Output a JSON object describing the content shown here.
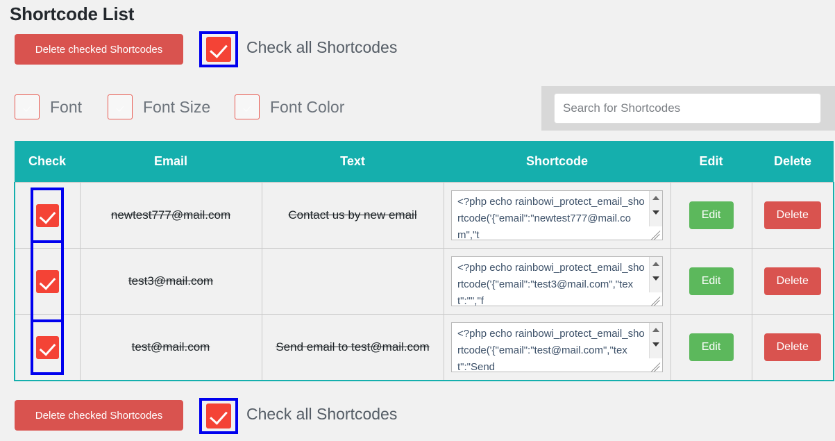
{
  "page": {
    "title": "Shortcode List",
    "colors": {
      "table_header_teal": "#15afad",
      "danger_red": "#d9534f",
      "checkbox_red": "#f44336",
      "edit_green": "#5cb85c",
      "focus_blue": "#0000ee",
      "page_background": "#f1f1f1",
      "search_panel_gray": "#d8d8d8"
    }
  },
  "toolbar_top": {
    "delete_checked_label": "Delete checked Shortcodes",
    "check_all_label": "Check all Shortcodes",
    "check_all_checked": true
  },
  "toolbar_bottom": {
    "delete_checked_label": "Delete checked Shortcodes",
    "check_all_label": "Check all Shortcodes",
    "check_all_checked": true
  },
  "filters": [
    {
      "label": "Font",
      "checked": false
    },
    {
      "label": "Font Size",
      "checked": false
    },
    {
      "label": "Font Color",
      "checked": false
    }
  ],
  "search": {
    "placeholder": "Search for Shortcodes",
    "value": ""
  },
  "table": {
    "columns": [
      "Check",
      "Email",
      "Text",
      "Shortcode",
      "Edit",
      "Delete"
    ],
    "rows": [
      {
        "checked": true,
        "email": "newtest777@mail.com",
        "text": "Contact us by new email",
        "shortcode": "<?php echo rainbowi_protect_email_shortcode('{\"email\":\"newtest777@mail.com\",\"t",
        "edit_label": "Edit",
        "delete_label": "Delete"
      },
      {
        "checked": true,
        "email": "test3@mail.com",
        "text": "",
        "shortcode": "<?php echo rainbowi_protect_email_shortcode('{\"email\":\"test3@mail.com\",\"text\":\"\",\"f",
        "edit_label": "Edit",
        "delete_label": "Delete"
      },
      {
        "checked": true,
        "email": "test@mail.com",
        "text": "Send email to test@mail.com",
        "shortcode": "<?php echo rainbowi_protect_email_shortcode('{\"email\":\"test@mail.com\",\"text\":\"Send",
        "edit_label": "Edit",
        "delete_label": "Delete"
      }
    ]
  }
}
